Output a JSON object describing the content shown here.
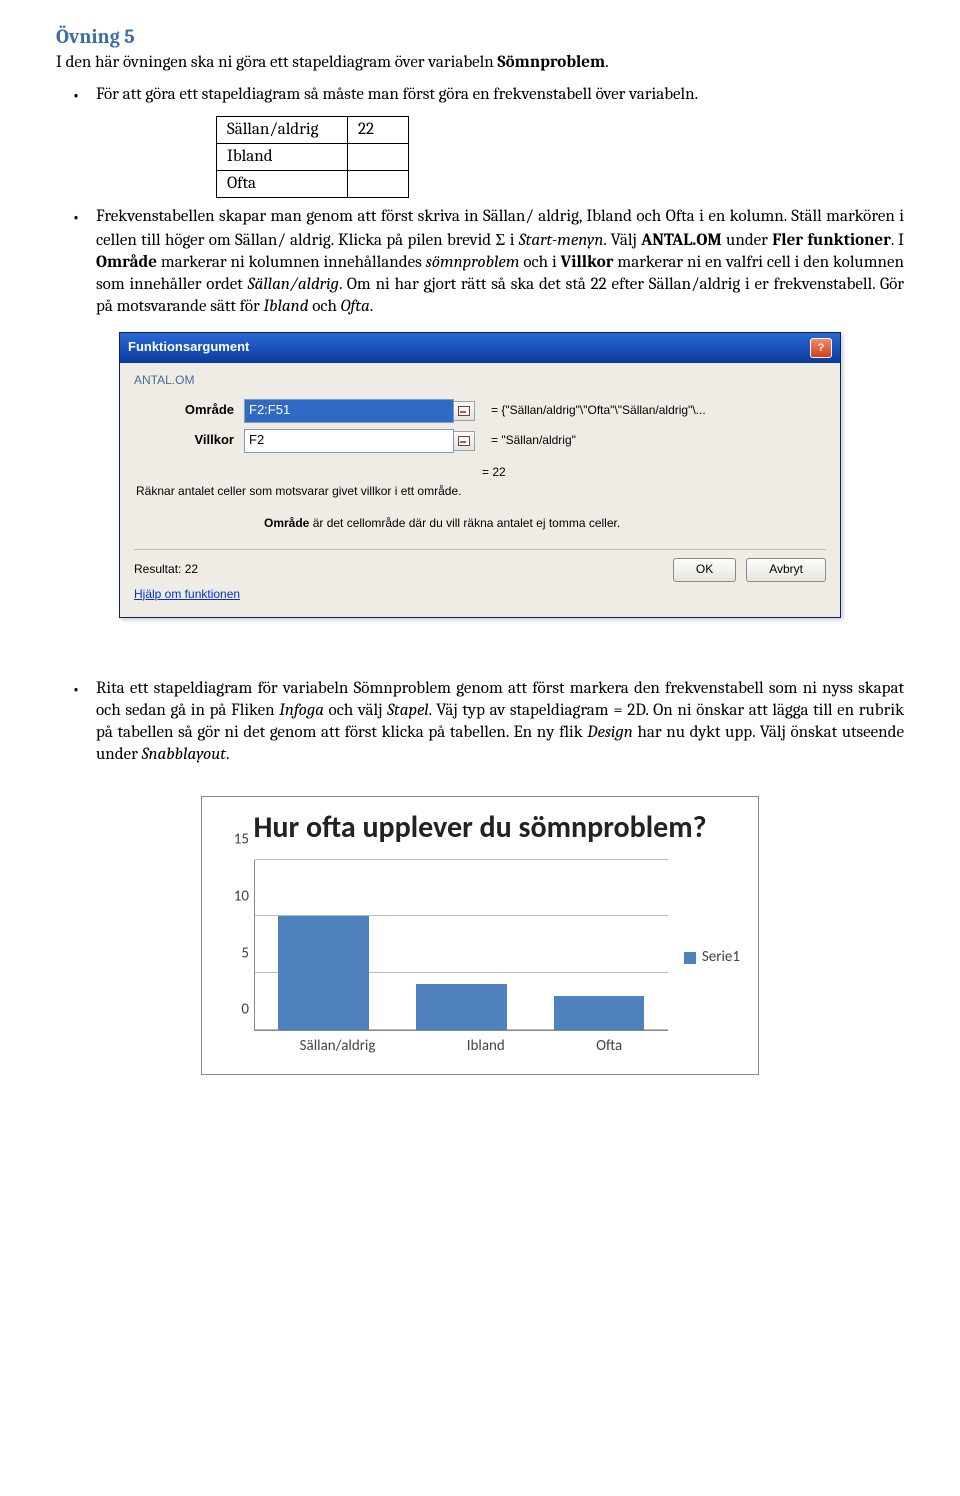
{
  "heading": "Övning 5",
  "intro_prefix": "I den här övningen ska ni göra ett stapeldiagram över variabeln ",
  "intro_bold": "Sömnproblem",
  "bullet1": "För att göra ett stapeldiagram så måste man först göra en frekvenstabell över variabeln.",
  "freq_table": {
    "rows": [
      {
        "label": "Sällan/aldrig",
        "value": "22"
      },
      {
        "label": "Ibland",
        "value": ""
      },
      {
        "label": "Ofta",
        "value": ""
      }
    ]
  },
  "bullet2": {
    "p1a": "Frekvenstabellen skapar man genom att först skriva in Sällan/ aldrig, Ibland och Ofta i en kolumn. Ställ markören i cellen till höger om Sällan/ aldrig. Klicka på pilen brevid ",
    "sigma": "Σ",
    "p1b": " i ",
    "p1c_i": "Start-menyn",
    "p1d": ". Välj ",
    "p1e_b": "ANTAL.OM",
    "p1f": " under ",
    "p1g_b": "Fler funktioner",
    "p1h": ". I ",
    "p1i_b": "Område",
    "p1j": " markerar ni kolumnen innehållandes ",
    "p1k_i": "sömnproblem",
    "p1l": " och i ",
    "p1m_b": "Villkor",
    "p1n": " markerar ni en valfri cell i den kolumnen som innehåller ordet ",
    "p1o_i": "Sällan/aldrig",
    "p1p": ". Om ni har gjort rätt så ska det stå 22 efter Sällan/aldrig i er frekvenstabell. Gör på motsvarande sätt för ",
    "p1q_i": "Ibland",
    "p1r": " och ",
    "p1s_i": "Ofta",
    "p1t": "."
  },
  "dialog": {
    "title": "Funktionsargument",
    "section": "ANTAL.OM",
    "omrade_label": "Område",
    "omrade_value": "F2:F51",
    "omrade_eval": "= {\"Sällan/aldrig\"\\\"Ofta\"\\\"Sällan/aldrig\"\\...",
    "villkor_label": "Villkor",
    "villkor_value": "F2",
    "villkor_eval": "= \"Sällan/aldrig\"",
    "result_eq": "= 22",
    "desc": "Räknar antalet celler som motsvarar givet villkor i ett område.",
    "desc2_b": "Område",
    "desc2_rest": "  är det cellområde där du vill räkna antalet ej tomma celler.",
    "result_label": "Resultat:  22",
    "help_link": "Hjälp om funktionen",
    "ok": "OK",
    "cancel": "Avbryt"
  },
  "bullet3": {
    "a": "Rita ett stapeldiagram för variabeln Sömnproblem genom att först markera den frekvenstabell som ni nyss skapat och sedan gå in på Fliken ",
    "b_i": "Infoga",
    "c": " och välj ",
    "d_i": "Stapel",
    "e": ". Väj typ av stapeldiagram = 2D. On ni önskar att lägga till en rubrik på tabellen så gör ni det genom att först klicka på tabellen. En ny flik ",
    "f_i": "Design",
    "g": " har nu dykt upp. Välj önskat utseende under ",
    "h_i": "Snabblayout",
    "i": "."
  },
  "chart_data": {
    "type": "bar",
    "title": "Hur ofta upplever du sömnproblem?",
    "categories": [
      "Sällan/aldrig",
      "Ibland",
      "Ofta"
    ],
    "values": [
      10,
      4,
      3
    ],
    "series_name": "Serie1",
    "yticks": [
      0,
      5,
      10,
      15
    ],
    "ylim": [
      0,
      15
    ]
  }
}
